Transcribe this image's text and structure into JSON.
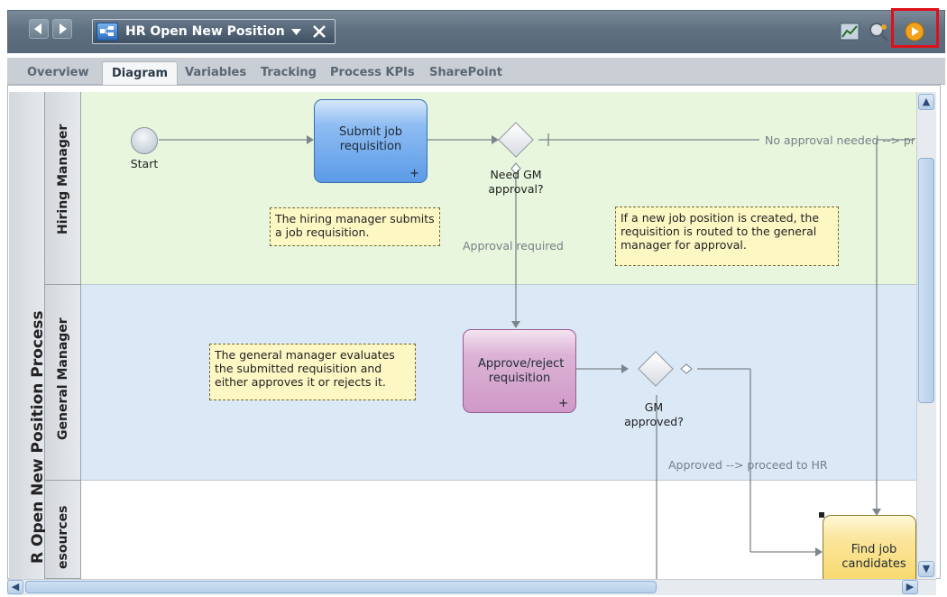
{
  "window": {
    "tab_title": "HR Open New Position",
    "nav_back_icon": "back-arrow-icon",
    "nav_forward_icon": "forward-arrow-icon",
    "menu_icon": "dropdown-triangle-icon",
    "close_icon": "close-icon",
    "toolbar_icons": [
      "chart-icon",
      "process-inspector-icon",
      "run-icon"
    ],
    "accent_highlight": "#e0101a"
  },
  "tabs": [
    {
      "label": "Overview",
      "active": false
    },
    {
      "label": "Diagram",
      "active": true
    },
    {
      "label": "Variables",
      "active": false
    },
    {
      "label": "Tracking",
      "active": false
    },
    {
      "label": "Process KPIs",
      "active": false
    },
    {
      "label": "SharePoint",
      "active": false
    }
  ],
  "diagram": {
    "pool_title": "R Open New Position Process",
    "lanes": [
      {
        "name": "Hiring Manager",
        "color": "#e7f6dc"
      },
      {
        "name": "General Manager",
        "color": "#dbe8f6"
      },
      {
        "name": "esources",
        "color": "#ffffff"
      }
    ],
    "start_event": {
      "label": "Start"
    },
    "tasks": [
      {
        "label": "Submit job requisition",
        "color": "#5b9be8",
        "marker": "+"
      },
      {
        "label": "Approve/reject requisition",
        "color": "#d9a9d2",
        "marker": "+"
      },
      {
        "label": "Find job candidates",
        "color": "#fbe59a",
        "marker": ""
      }
    ],
    "gateways": [
      {
        "label_line1": "Need GM",
        "label_line2": "approval?"
      },
      {
        "label_line1": "GM",
        "label_line2": "approved?"
      }
    ],
    "flow_labels": {
      "no_approval": "No approval needed --> pr",
      "approval_required": "Approval required",
      "approved": "Approved --> proceed to HR"
    },
    "notes": [
      "The hiring manager submits a job requisition.",
      "If a new job position is created, the requisition is routed to the general manager for approval.",
      "The general manager evaluates the submitted requisition and either approves it or rejects it."
    ]
  }
}
